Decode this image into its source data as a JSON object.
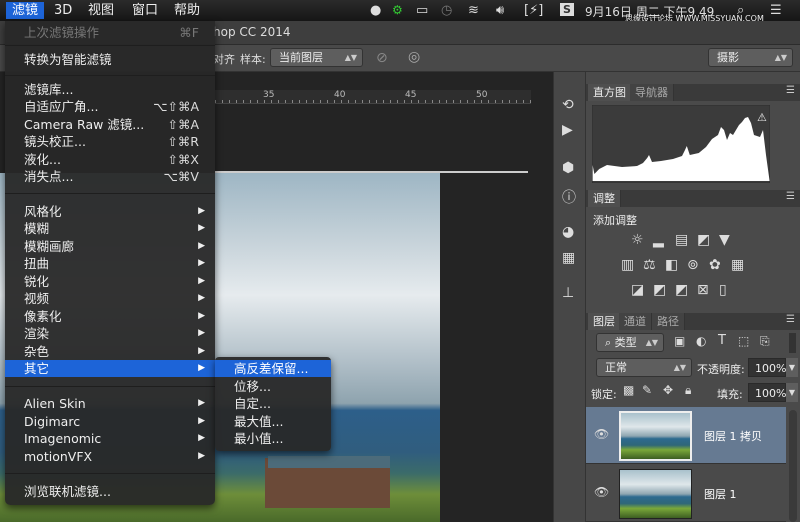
{
  "menubar": {
    "items": [
      "滤镜",
      "3D",
      "视图",
      "窗口",
      "帮助"
    ],
    "clock": "9月16日 周二 下午9 49",
    "watermark": "思缘设计论坛 WWW.MISSYUAN.COM"
  },
  "app_title": "hop CC 2014",
  "options": {
    "align": "对齐",
    "sample_label": "样本:",
    "sample_value": "当前图层",
    "workspace": "摄影"
  },
  "ruler": [
    "35",
    "40",
    "45",
    "50"
  ],
  "filter_menu": {
    "last": {
      "label": "上次滤镜操作",
      "shortcut": "⌘F"
    },
    "smart": "转换为智能滤镜",
    "group1": [
      {
        "label": "滤镜库...",
        "shortcut": ""
      },
      {
        "label": "自适应广角...",
        "shortcut": "⌥⇧⌘A"
      },
      {
        "label": "Camera Raw 滤镜...",
        "shortcut": "⇧⌘A"
      },
      {
        "label": "镜头校正...",
        "shortcut": "⇧⌘R"
      },
      {
        "label": "液化...",
        "shortcut": "⇧⌘X"
      },
      {
        "label": "消失点...",
        "shortcut": "⌥⌘V"
      }
    ],
    "group2": [
      "风格化",
      "模糊",
      "模糊画廊",
      "扭曲",
      "锐化",
      "视频",
      "像素化",
      "渲染",
      "杂色",
      "其它"
    ],
    "group3": [
      "Alien Skin",
      "Digimarc",
      "Imagenomic",
      "motionVFX"
    ],
    "browse": "浏览联机滤镜..."
  },
  "other_submenu": [
    "高反差保留...",
    "位移...",
    "自定...",
    "最大值...",
    "最小值..."
  ],
  "histogram_panel": {
    "tabs": [
      "直方图",
      "导航器"
    ]
  },
  "adjust_panel": {
    "tab": "调整",
    "heading": "添加调整"
  },
  "layers_panel": {
    "tabs": [
      "图层",
      "通道",
      "路径"
    ],
    "filter": "类型",
    "blend": "正常",
    "opacity_label": "不透明度:",
    "opacity": "100%",
    "lock_label": "锁定:",
    "fill_label": "填充:",
    "fill": "100%",
    "layers": [
      {
        "name": "图层 1 拷贝",
        "selected": true
      },
      {
        "name": "图层 1",
        "selected": false
      }
    ]
  },
  "colors": {
    "accent": "#1d64d8",
    "layer_selected": "#667a92"
  }
}
